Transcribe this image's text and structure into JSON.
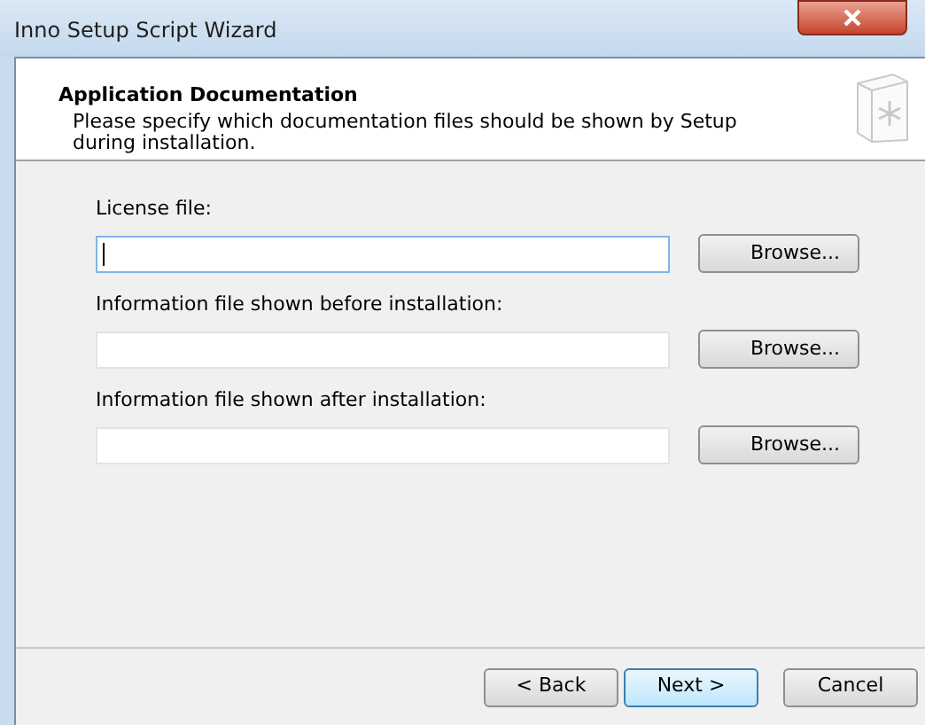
{
  "window": {
    "title": "Inno Setup Script Wizard"
  },
  "header": {
    "title": "Application Documentation",
    "description": "Please specify which documentation files should be shown by Setup during installation."
  },
  "fields": [
    {
      "label": "License file:",
      "focused": true,
      "button": "Browse..."
    },
    {
      "label": "Information file shown before installation:",
      "focused": false,
      "button": "Browse..."
    },
    {
      "label": "Information file shown after installation:",
      "focused": false,
      "button": "Browse..."
    }
  ],
  "buttons": [
    {
      "label": "< Back",
      "default": false
    },
    {
      "label": "Next >",
      "default": true
    },
    {
      "label": "Cancel",
      "default": false
    }
  ]
}
